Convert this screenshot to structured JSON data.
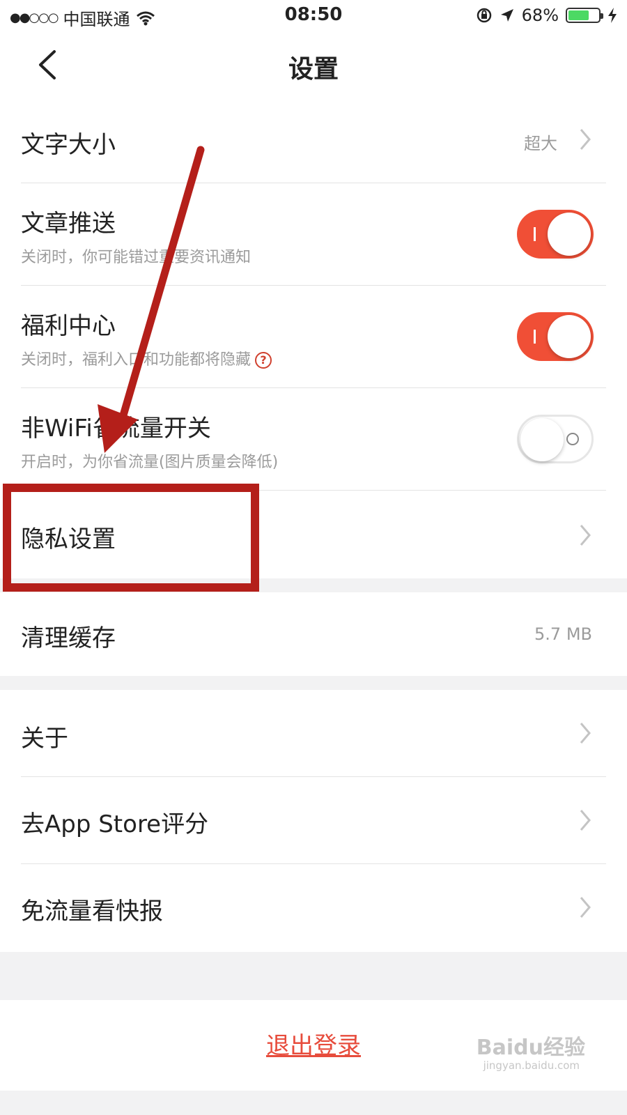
{
  "status_bar": {
    "signal": "●●○○○",
    "carrier": "中国联通",
    "time": "08:50",
    "battery_percent": "68%",
    "battery_level": 0.68,
    "accent_battery": "#4cd964"
  },
  "nav": {
    "title": "设置"
  },
  "settings": {
    "font_size": {
      "label": "文字大小",
      "value": "超大"
    },
    "article_push": {
      "label": "文章推送",
      "subtitle": "关闭时，你可能错过重要资讯通知",
      "enabled": true
    },
    "welfare_center": {
      "label": "福利中心",
      "subtitle": "关闭时，福利入口和功能都将隐藏",
      "enabled": true
    },
    "data_saver": {
      "label": "非WiFi省流量开关",
      "subtitle": "开启时，为你省流量(图片质量会降低)",
      "enabled": false
    },
    "privacy": {
      "label": "隐私设置"
    },
    "clear_cache": {
      "label": "清理缓存",
      "value": "5.7 MB"
    },
    "about": {
      "label": "关于"
    },
    "rate": {
      "label": "去App Store评分"
    },
    "free_data": {
      "label": "免流量看快报"
    }
  },
  "logout": {
    "label": "退出登录"
  },
  "watermark": {
    "brand": "Baidu经验",
    "url": "jingyan.baidu.com"
  },
  "colors": {
    "toggle_on": "#f04f36",
    "logout_text": "#e74c3c",
    "annotation": "#b41f1a"
  }
}
